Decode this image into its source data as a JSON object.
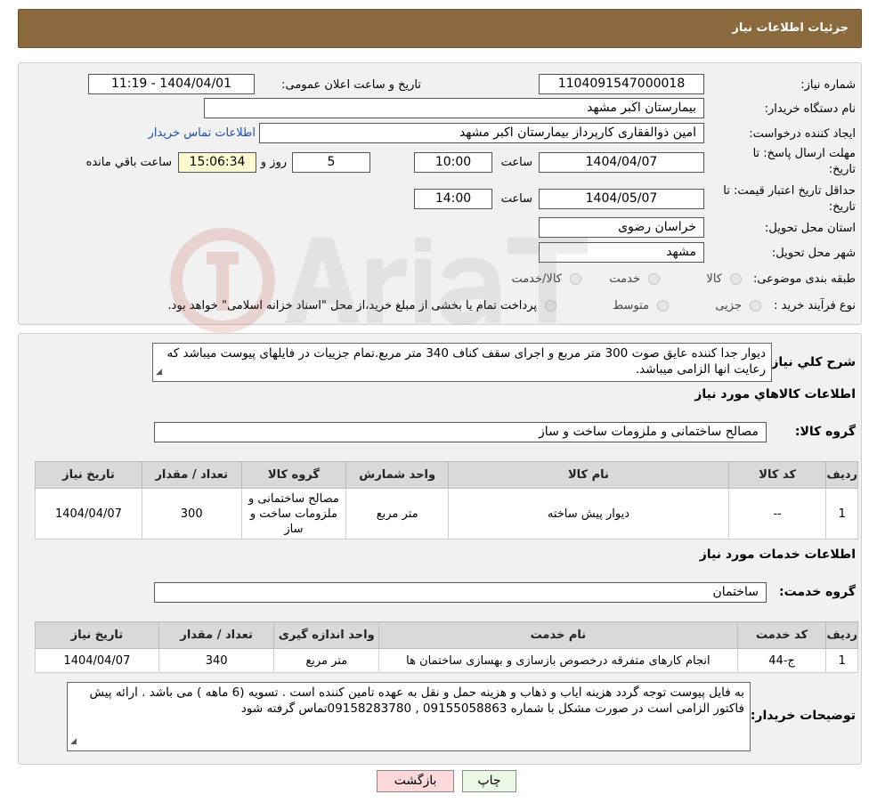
{
  "header": {
    "title": "جزئیات اطلاعات نیاز"
  },
  "info": {
    "need_number_label": "شماره نیاز:",
    "need_number": "1104091547000018",
    "announce_label": "تاریخ و ساعت اعلان عمومی:",
    "announce_value": "1404/04/01 - 11:19",
    "buyer_label": "نام دستگاه خریدار:",
    "buyer_value": "بیمارستان اکبر مشهد",
    "creator_label": "ایجاد کننده درخواست:",
    "creator_value": "امین ذوالفقاری کارپرداز بیمارستان اکبر مشهد",
    "contact_link": "اطلاعات تماس خریدار",
    "deadline_label_1": "مهلت ارسال پاسخ: تا",
    "deadline_label_2": "تاریخ:",
    "deadline_date": "1404/04/07",
    "time_label": "ساعت",
    "deadline_time": "10:00",
    "days_value": "5",
    "days_label": "روز و",
    "remaining_time": "15:06:34",
    "remaining_label": "ساعت باقي مانده",
    "validity_label_1": "حداقل تاریخ اعتبار قیمت: تا",
    "validity_label_2": "تاریخ:",
    "validity_date": "1404/05/07",
    "validity_time": "14:00",
    "province_label": "استان محل تحویل:",
    "province_value": "خراسان رضوی",
    "city_label": "شهر محل تحویل:",
    "city_value": "مشهد",
    "category_label": "طبقه بندی موضوعی:",
    "category_options": [
      "کالا",
      "خدمت",
      "کالا/خدمت"
    ],
    "process_label": "نوع فرآیند خرید :",
    "process_options": [
      "جزیی",
      "متوسط"
    ],
    "process_note": "پرداخت تمام یا بخشی از مبلغ خرید،از محل \"اسناد خزانه اسلامی\" خواهد بود."
  },
  "description": {
    "label": "شرح کلي نياز:",
    "text": "دیوار جدا کننده عایق صوت 300 متر مربع و اجرای سقف کناف 340 متر مربع.تمام جزییات در فایلهای پیوست میباشد که رعایت انها الزامی میباشد."
  },
  "goods": {
    "section_title": "اطلاعات کالاهاي مورد نياز",
    "group_label": "گروه کالا:",
    "group_value": "مصالح ساختمانی و ملزومات ساخت و ساز",
    "columns": [
      "ردیف",
      "کد کالا",
      "نام کالا",
      "واحد شمارش",
      "گروه کالا",
      "تعداد / مقدار",
      "تاریخ نیاز"
    ],
    "rows": [
      [
        "1",
        "--",
        "دیوار پیش ساخته",
        "متر مربع",
        "مصالح ساختمانی و ملزومات ساخت و ساز",
        "300",
        "1404/04/07"
      ]
    ]
  },
  "services": {
    "section_title": "اطلاعات خدمات مورد نياز",
    "group_label": "گروه خدمت:",
    "group_value": "ساختمان",
    "columns": [
      "ردیف",
      "کد خدمت",
      "نام خدمت",
      "واحد اندازه گیری",
      "تعداد / مقدار",
      "تاریخ نیاز"
    ],
    "rows": [
      [
        "1",
        "ج-44",
        "انجام کارهای متفرقه درخصوص بازسازی و بهسازی ساختمان ها",
        "متر مربع",
        "340",
        "1404/04/07"
      ]
    ]
  },
  "buyer_notes": {
    "label": "توضیحات خریدار:",
    "text": "به فایل پیوست توجه گردد هزینه ایاب و ذهاب  و هزینه حمل و نقل به عهده تامین کننده است . تسویه (6 ماهه ) می باشد . ارائه پیش فاکتور الزامی است در صورت مشکل با شماره 09155058863 , 09158283780تماس گرفته شود"
  },
  "buttons": {
    "print": "چاپ",
    "back": "بازگشت"
  },
  "colors": {
    "header_bg": "#8a6a3d",
    "panel_bg": "#f1f1f1",
    "remaining_bg": "#fffbd0",
    "back_bg": "#fdd8d8",
    "print_bg": "#eaf8e6",
    "link": "#1a4fb5"
  }
}
